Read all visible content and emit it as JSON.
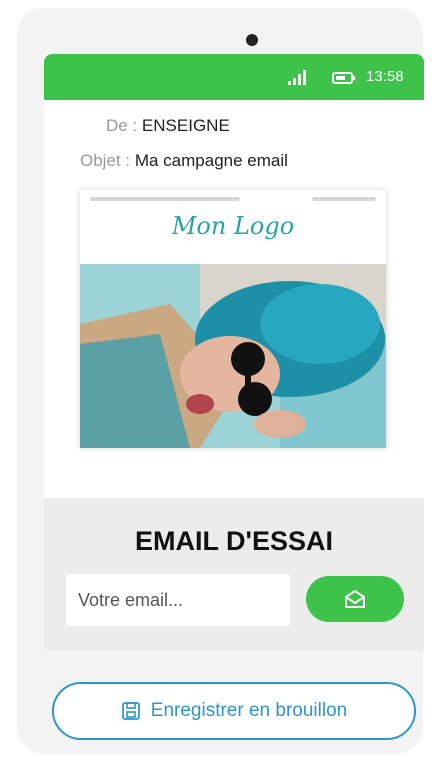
{
  "status_bar": {
    "time": "13:58",
    "signal_icon": "signal-icon",
    "battery_icon": "battery-icon",
    "color": "#3dc24a"
  },
  "email_meta": {
    "from_label": "De :",
    "from_value": "ENSEIGNE",
    "subject_label": "Objet :",
    "subject_value": "Ma campagne email"
  },
  "preview": {
    "logo_text": "Mon Logo",
    "logo_color": "#2aa3a3",
    "image": "woman-teal-hair-sunglasses-photo"
  },
  "test_email": {
    "title": "EMAIL D'ESSAI",
    "input_placeholder": "Votre email...",
    "input_value": "",
    "send_icon": "envelope-open-icon",
    "button_color": "#3dc24a"
  },
  "draft": {
    "label": "Enregistrer en brouillon",
    "icon": "save-icon",
    "color": "#2f95c8"
  }
}
